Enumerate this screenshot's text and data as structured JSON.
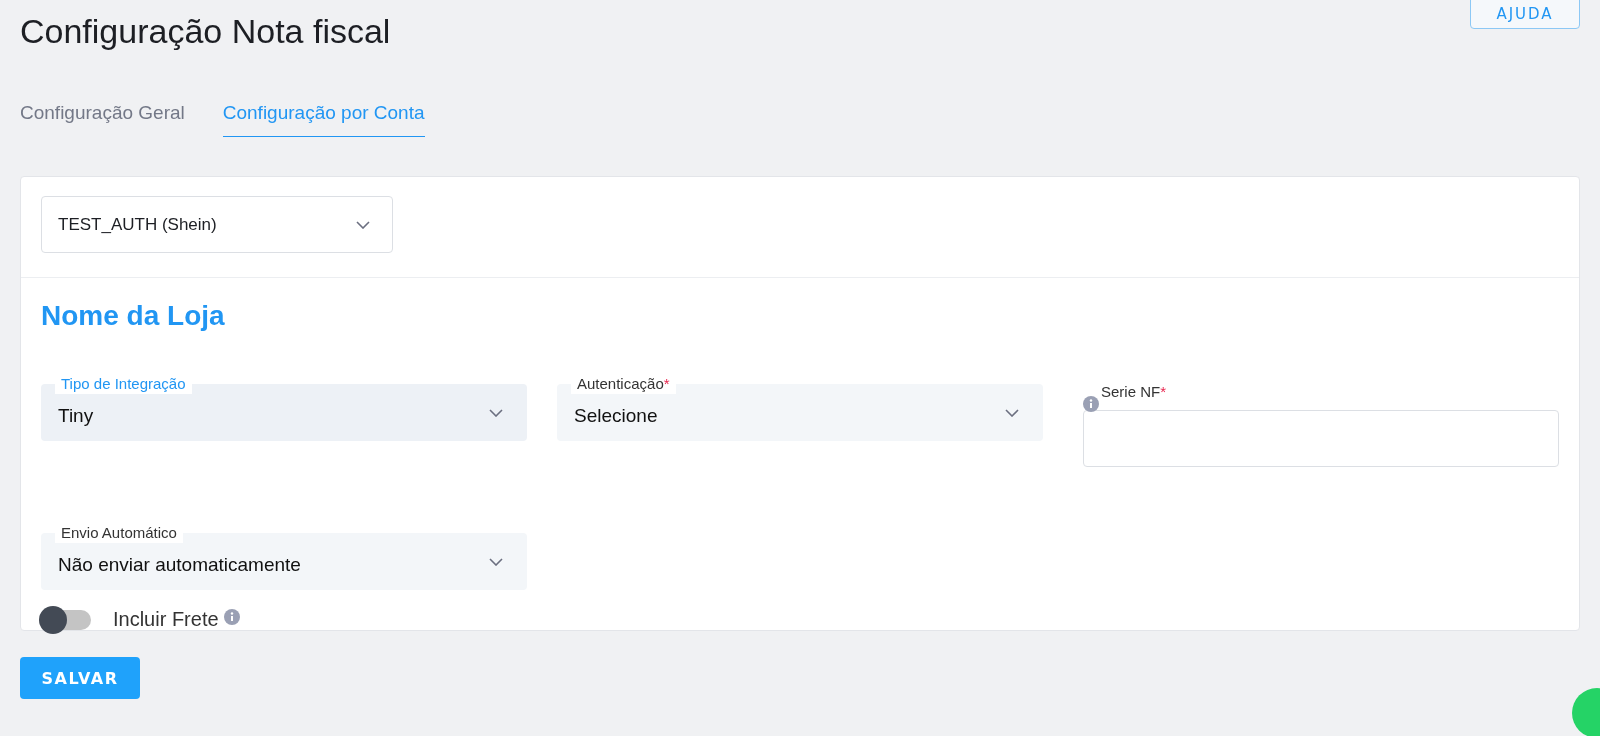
{
  "page": {
    "title": "Configuração Nota fiscal",
    "help_button": "AJUDA"
  },
  "tabs": [
    {
      "label": "Configuração Geral",
      "selected": false
    },
    {
      "label": "Configuração por Conta",
      "selected": true
    }
  ],
  "account_select": {
    "value": "TEST_AUTH (Shein)"
  },
  "section_title": "Nome da Loja",
  "fields": [
    {
      "kind": "select",
      "label": "Tipo de Integração",
      "value": "Tiny",
      "required": false,
      "focused": true,
      "info": false
    },
    {
      "kind": "select",
      "label": "Autenticação",
      "value": "Selecione",
      "required": true,
      "focused": false,
      "info": false
    },
    {
      "kind": "text",
      "label": "Serie NF",
      "required": true,
      "focused": false,
      "info": true
    },
    {
      "kind": "select",
      "label": "Envio Automático",
      "value": "Não enviar automaticamente",
      "required": false,
      "focused": false,
      "info": false
    }
  ],
  "required_mark": "*",
  "toggle": {
    "label": "Incluir Frete",
    "on": false
  },
  "save_button": "SALVAR"
}
